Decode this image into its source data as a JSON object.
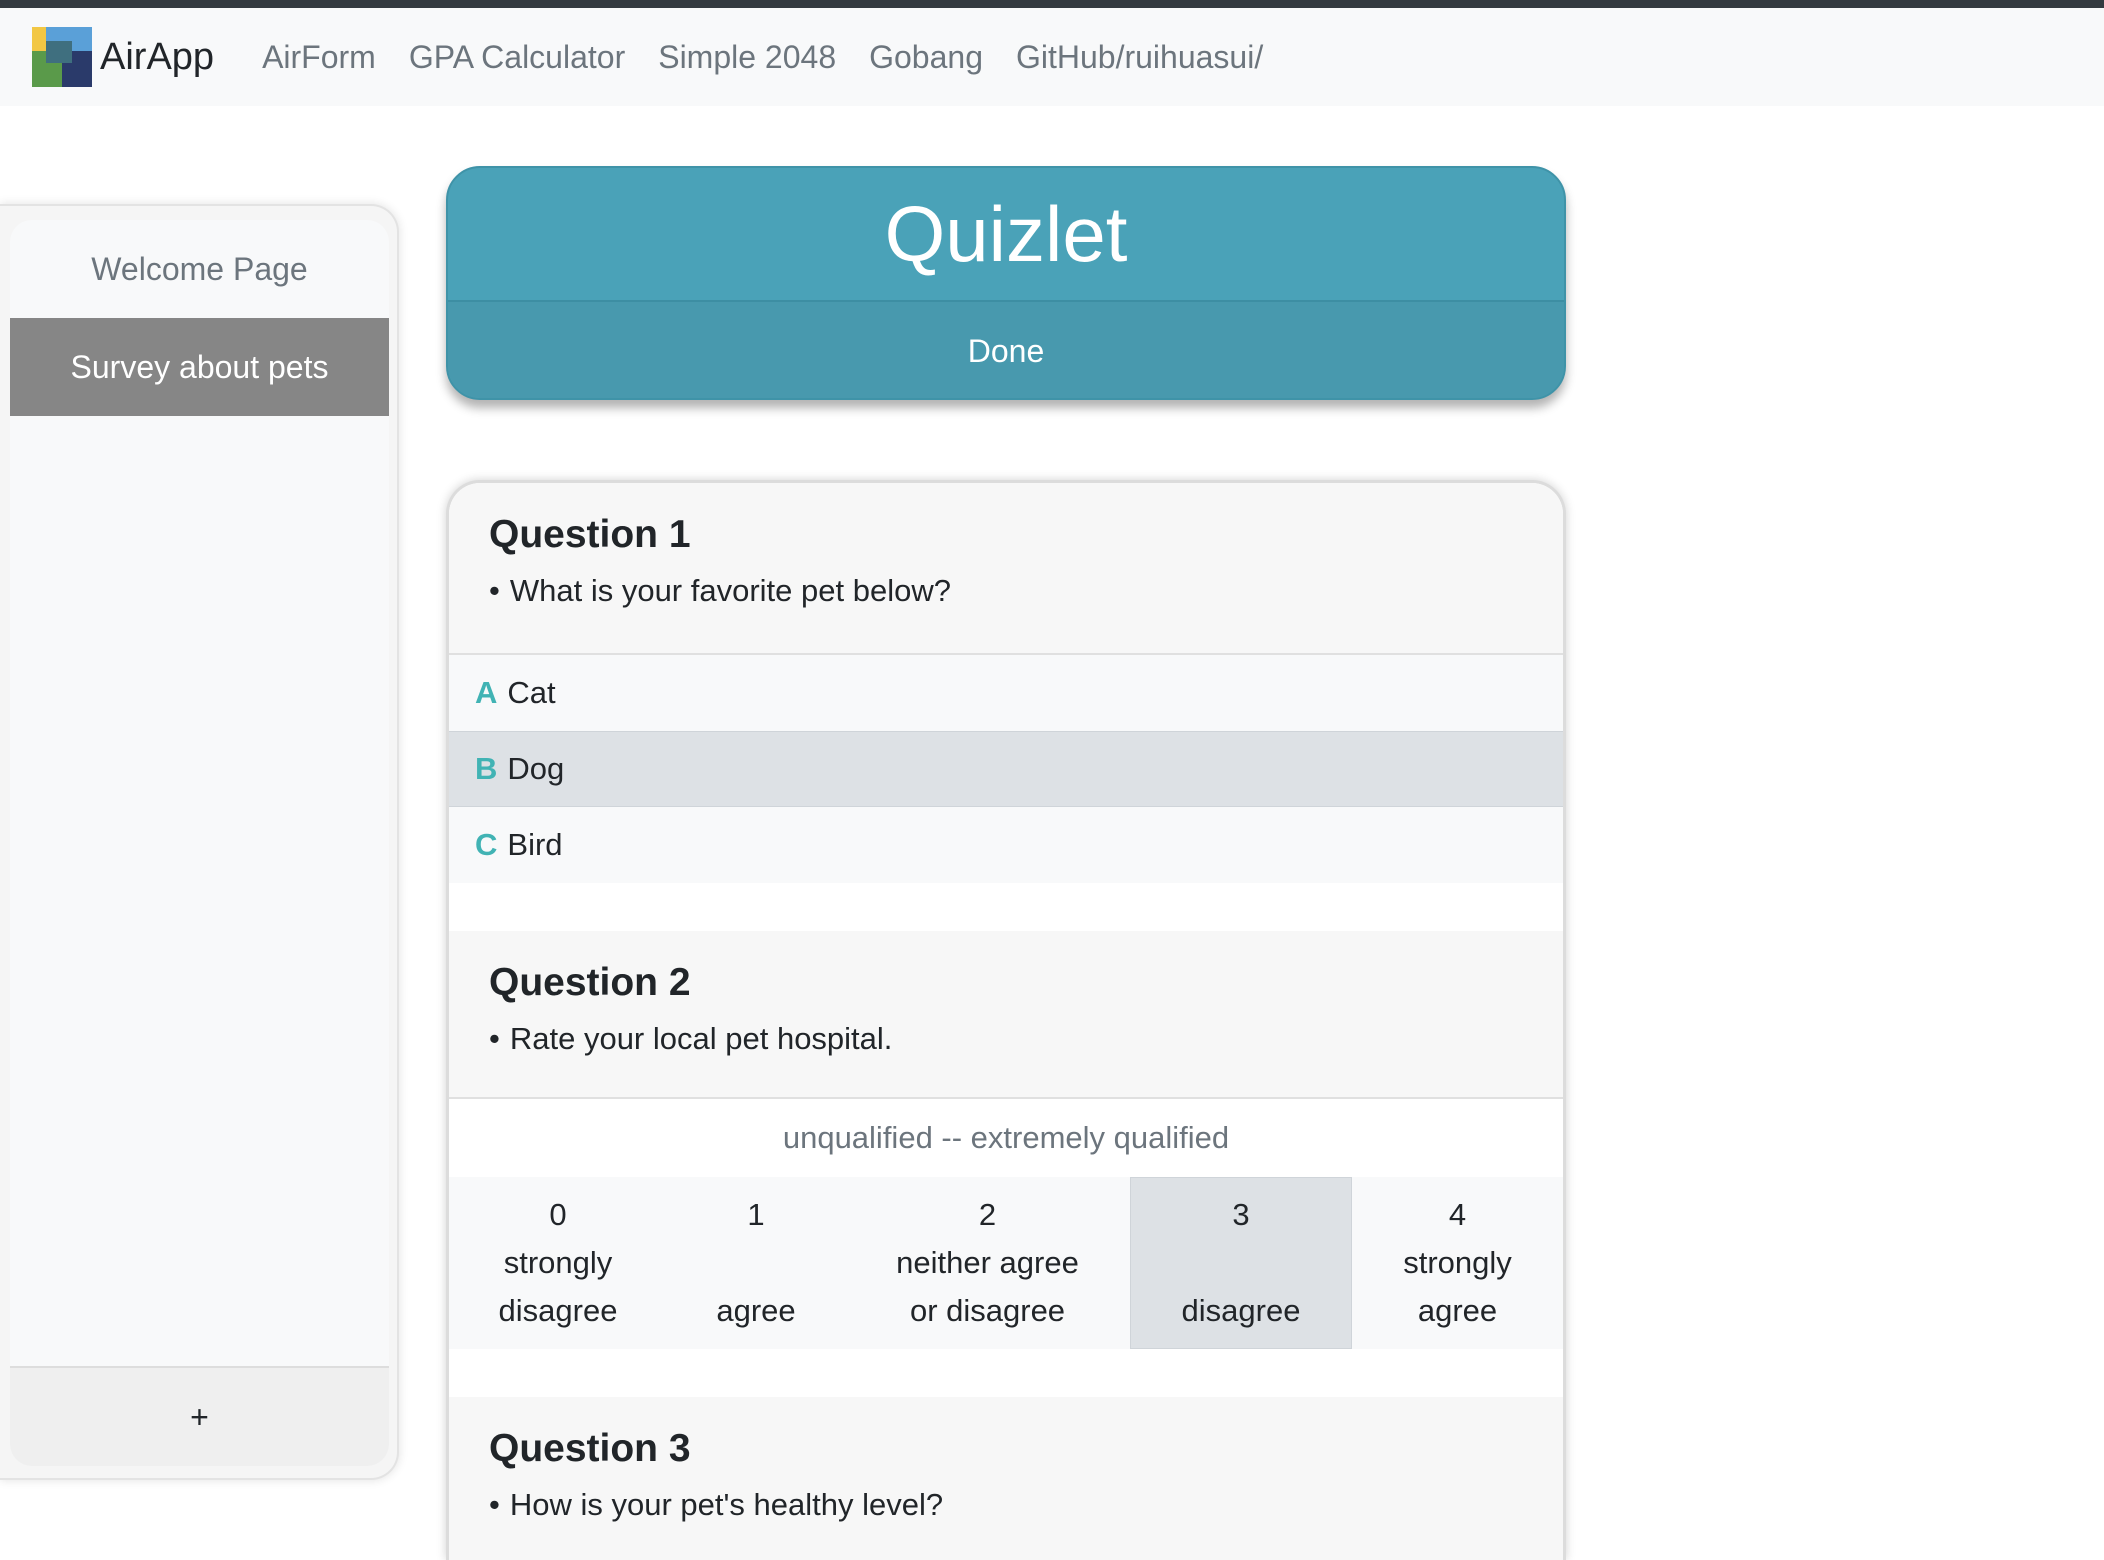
{
  "navbar": {
    "brand": "AirApp",
    "links": [
      "AirForm",
      "GPA Calculator",
      "Simple 2048",
      "Gobang",
      "GitHub/ruihuasui/"
    ]
  },
  "sidebar": {
    "items": [
      {
        "label": "Welcome Page",
        "active": false
      },
      {
        "label": "Survey about pets",
        "active": true
      }
    ],
    "add_label": "+"
  },
  "header": {
    "title": "Quizlet",
    "done_label": "Done"
  },
  "questions": [
    {
      "title": "Question 1",
      "text": "What is your favorite pet below?",
      "options": [
        {
          "letter": "A",
          "label": "Cat"
        },
        {
          "letter": "B",
          "label": "Dog"
        },
        {
          "letter": "C",
          "label": "Bird"
        }
      ],
      "selected": "B"
    },
    {
      "title": "Question 2",
      "text": "Rate your local pet hospital.",
      "scale_label": "unqualified -- extremely qualified",
      "scale": [
        {
          "value": "0",
          "line1": "strongly",
          "line2": "disagree"
        },
        {
          "value": "1",
          "line1": "",
          "line2": "agree"
        },
        {
          "value": "2",
          "line1": "neither agree",
          "line2": "or disagree"
        },
        {
          "value": "3",
          "line1": "",
          "line2": "disagree"
        },
        {
          "value": "4",
          "line1": "strongly",
          "line2": "agree"
        }
      ],
      "selected": "3"
    },
    {
      "title": "Question 3",
      "text": "How is your pet's healthy level?"
    }
  ],
  "bullet": "•",
  "colors": {
    "header_bg": "#4aa2b8",
    "option_letter": "#41b3b4",
    "selected_bg": "#dde1e5",
    "sidebar_active_bg": "#868686"
  }
}
